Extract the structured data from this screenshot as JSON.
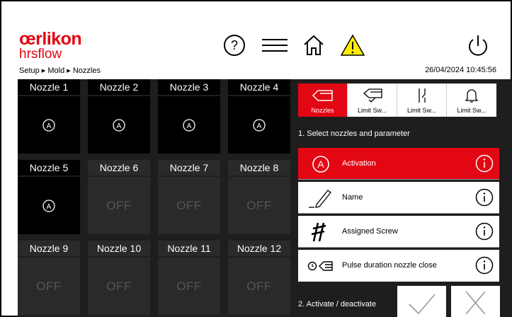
{
  "header": {
    "brand": "œrlikon",
    "brand_sub": "hrsflow",
    "breadcrumb": "Setup ▸ Mold ▸ Nozzles",
    "datetime": "26/04/2024 10:45:56",
    "icons": [
      "help-icon",
      "menu-icon",
      "home-icon",
      "warning-icon",
      "power-icon"
    ]
  },
  "nozzles": [
    {
      "title": "Nozzle 1",
      "state": "on"
    },
    {
      "title": "Nozzle 2",
      "state": "on"
    },
    {
      "title": "Nozzle 3",
      "state": "on"
    },
    {
      "title": "Nozzle 4",
      "state": "on"
    },
    {
      "title": "Nozzle 5",
      "state": "on"
    },
    {
      "title": "Nozzle 6",
      "state": "off",
      "label": "OFF"
    },
    {
      "title": "Nozzle 7",
      "state": "off",
      "label": "OFF"
    },
    {
      "title": "Nozzle 8",
      "state": "off",
      "label": "OFF"
    },
    {
      "title": "Nozzle 9",
      "state": "off",
      "label": "OFF"
    },
    {
      "title": "Nozzle 10",
      "state": "off",
      "label": "OFF"
    },
    {
      "title": "Nozzle 11",
      "state": "off",
      "label": "OFF"
    },
    {
      "title": "Nozzle 12",
      "state": "off",
      "label": "OFF"
    }
  ],
  "tabs": [
    {
      "label": "Nozzles",
      "active": true
    },
    {
      "label": "Limit Sw...",
      "active": false
    },
    {
      "label": "Limit Sw...",
      "active": false
    },
    {
      "label": "Limit Sw...",
      "active": false
    }
  ],
  "step1": "1. Select nozzles and parameter",
  "params": [
    {
      "label": "Activation",
      "active": true,
      "icon": "activation-icon"
    },
    {
      "label": "Name",
      "active": false,
      "icon": "pencil-icon"
    },
    {
      "label": "Assigned Screw",
      "active": false,
      "icon": "screw-icon"
    },
    {
      "label": "Pulse duration nozzle close",
      "active": false,
      "icon": "timer-nozzle-icon"
    }
  ],
  "step2": "2. Activate / deactivate",
  "colors": {
    "accent": "#e30613",
    "tile_on": "#000000",
    "tile_off": "#2a2a2a"
  }
}
